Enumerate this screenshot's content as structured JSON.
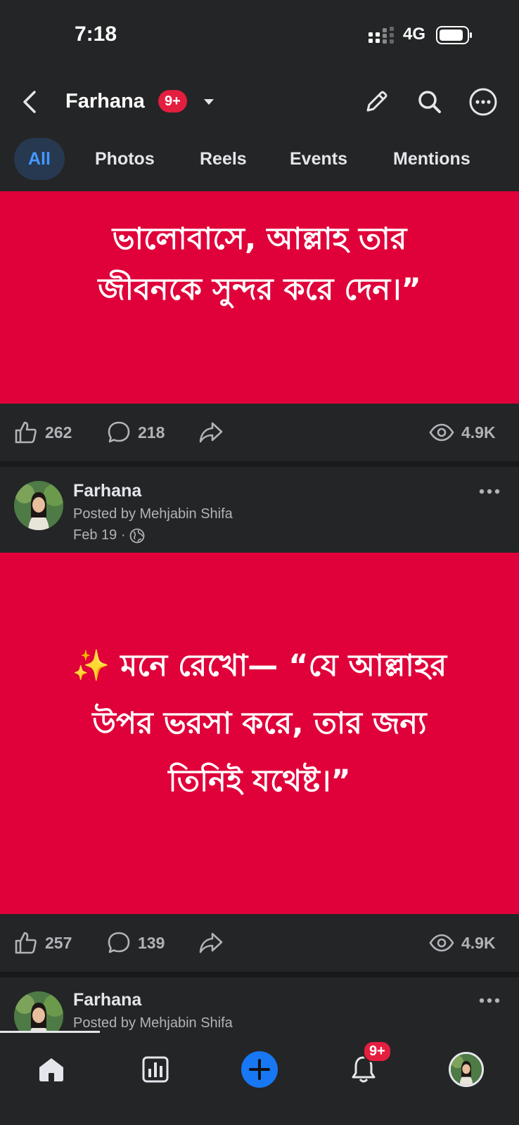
{
  "status_bar": {
    "time": "7:18",
    "network": "4G"
  },
  "header": {
    "title": "Farhana",
    "badge": "9+"
  },
  "tabs": [
    {
      "label": "All",
      "active": true
    },
    {
      "label": "Photos",
      "active": false
    },
    {
      "label": "Reels",
      "active": false
    },
    {
      "label": "Events",
      "active": false
    },
    {
      "label": "Mentions",
      "active": false
    }
  ],
  "post1": {
    "text_lines": [
      "ভালোবাসে, আল্লাহ তার",
      "জীবনকে সুন্দর করে দেন।”"
    ],
    "likes": "262",
    "comments": "218",
    "views": "4.9K"
  },
  "post2": {
    "author": "Farhana",
    "posted_by": "Posted by Mehjabin Shifa",
    "date": "Feb 19 ·",
    "sparkle": "✨",
    "text_lines": [
      "মনে রেখো— “যে আল্লাহর",
      "উপর ভরসা করে, তার জন্য",
      "তিনিই যথেষ্ট।”"
    ],
    "likes": "257",
    "comments": "139",
    "views": "4.9K"
  },
  "post3": {
    "author": "Farhana",
    "posted_by": "Posted by Mehjabin Shifa"
  },
  "bottom_nav": {
    "notifications_badge": "9+"
  },
  "colors": {
    "post_bg": "#e0003a",
    "accent": "#1877f2",
    "badge": "#e41e3f"
  }
}
